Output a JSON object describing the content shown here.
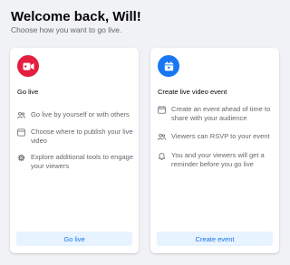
{
  "header": {
    "title": "Welcome back, Will!",
    "subtitle": "Choose how you want to go live."
  },
  "colors": {
    "go_live_icon_bg": "#e41e3f",
    "event_icon_bg": "#1877f2",
    "button_bg": "#e7f3ff",
    "button_text": "#1b74e4",
    "muted_text": "#65676b"
  },
  "go_live_card": {
    "icon": "video-camera-icon",
    "heading": "Go live",
    "features": [
      {
        "icon": "people-icon",
        "text": "Go live by yourself or with others"
      },
      {
        "icon": "publish-window-icon",
        "text": "Choose where to publish your live video"
      },
      {
        "icon": "gear-icon",
        "text": "Explore additional tools to engage your viewers"
      }
    ],
    "button_label": "Go live"
  },
  "event_card": {
    "icon": "calendar-event-icon",
    "heading": "Create live video event",
    "features": [
      {
        "icon": "calendar-icon",
        "text": "Create an event ahead of time to share with your audience"
      },
      {
        "icon": "people-icon",
        "text": "Viewers can RSVP to your event"
      },
      {
        "icon": "bell-icon",
        "text": "You and your viewers will get a reminder before you go live"
      }
    ],
    "button_label": "Create event"
  }
}
